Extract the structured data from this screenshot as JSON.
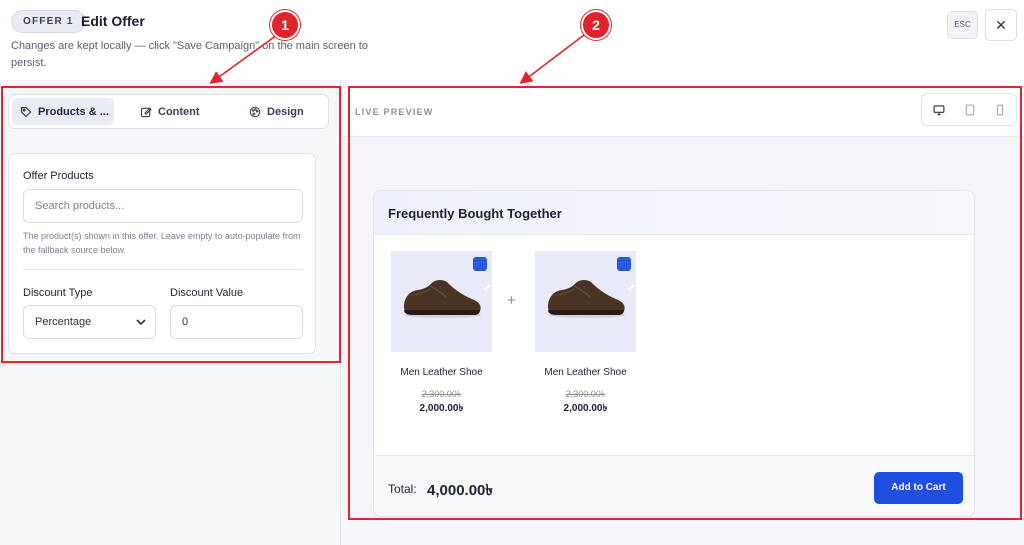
{
  "header": {
    "badge": "OFFER 1",
    "title": "Edit Offer",
    "subtitle": "Changes are kept locally — click \"Save Campaign\" on the main screen to persist.",
    "esc_label": "ESC",
    "close_glyph": "✕"
  },
  "tabs": [
    {
      "label": "Products & ...",
      "icon": "tag-icon",
      "active": true
    },
    {
      "label": "Content",
      "icon": "edit-icon",
      "active": false
    },
    {
      "label": "Design",
      "icon": "palette-icon",
      "active": false
    }
  ],
  "form": {
    "offer_products_label": "Offer Products",
    "search_placeholder": "Search products...",
    "search_value": "",
    "help_text": "The product(s) shown in this offer. Leave empty to auto-populate from the fallback source below.",
    "discount_type_label": "Discount Type",
    "discount_type_value": "Percentage",
    "discount_value_label": "Discount Value",
    "discount_value": "0"
  },
  "preview": {
    "label": "LIVE PREVIEW",
    "devices": [
      {
        "icon": "desktop-icon",
        "active": true
      },
      {
        "icon": "tablet-icon",
        "active": false
      },
      {
        "icon": "mobile-icon",
        "active": false
      }
    ],
    "widget": {
      "title": "Frequently Bought Together",
      "plus": "+",
      "products": [
        {
          "name": "Men Leather Shoe",
          "old_price": "2,300.00৳",
          "new_price": "2,000.00৳",
          "checked": true
        },
        {
          "name": "Men Leather Shoe",
          "old_price": "2,300.00৳",
          "new_price": "2,000.00৳",
          "checked": true
        }
      ],
      "total_label": "Total:",
      "total_value": "4,000.00৳",
      "add_button": "Add to Cart"
    }
  },
  "annotations": [
    {
      "number": "1"
    },
    {
      "number": "2"
    }
  ],
  "colors": {
    "accent": "#1f4fe0",
    "annotation": "#e0242b"
  }
}
